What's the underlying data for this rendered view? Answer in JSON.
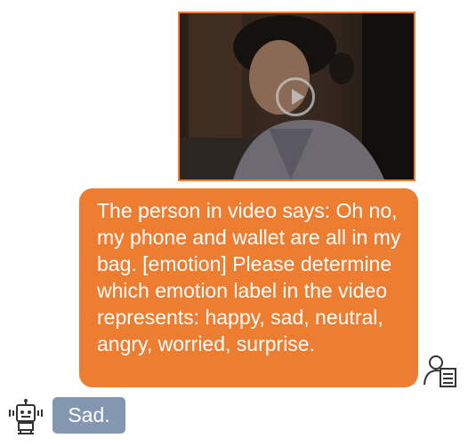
{
  "chat": {
    "user_message": {
      "video": {
        "media_icon": "play-icon"
      },
      "text": "The person in video says: Oh no, my phone and wallet are all in my bag. [emotion] Please determine which emotion label in the video represents: happy, sad, neutral, angry, worried, surprise.",
      "avatar_icon": "user-document-icon"
    },
    "bot_message": {
      "text": "Sad.",
      "avatar_icon": "robot-icon"
    }
  },
  "colors": {
    "user_bubble": "#ed7d31",
    "bot_bubble": "#8497b0",
    "video_border": "#ed7d31"
  }
}
